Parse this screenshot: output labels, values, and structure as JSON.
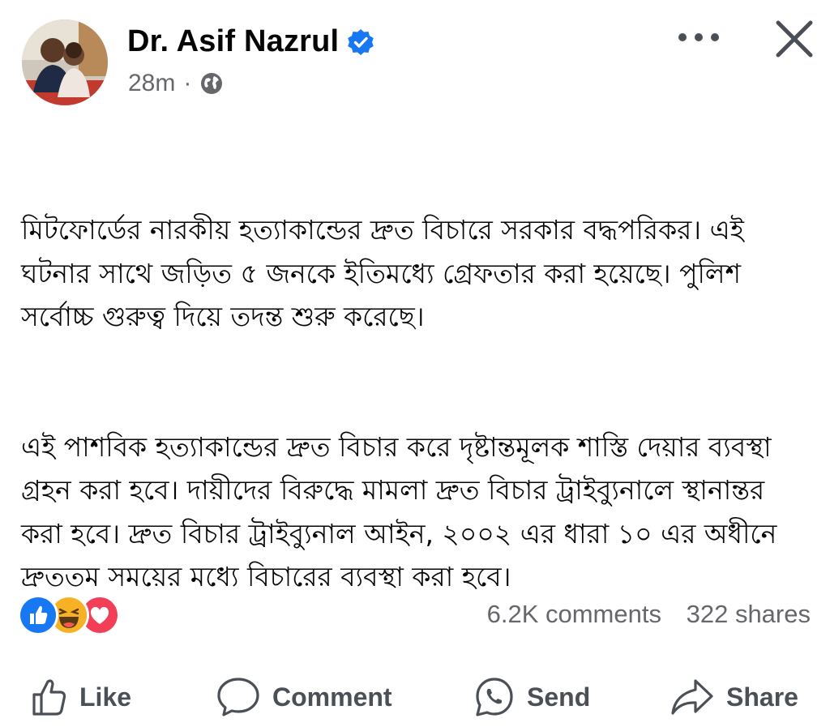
{
  "author": {
    "name": "Dr. Asif Nazrul",
    "verified_icon": "verified-badge-icon",
    "timestamp": "28m",
    "separator": "·",
    "audience_icon": "globe-icon"
  },
  "header_actions": {
    "more_icon": "more-options-icon",
    "close_icon": "close-icon"
  },
  "post": {
    "paragraph_1": "মিটফোর্ডের নারকীয় হত্যাকান্ডের দ্রুত বিচারে সরকার বদ্ধপরিকর। এই ঘটনার সাথে জড়িত ৫ জনকে ইতিমধ্যে গ্রেফতার করা হয়েছে। পুলিশ সর্বোচ্চ গুরুত্ব দিয়ে তদন্ত শুরু করেছে।",
    "paragraph_2": "এই পাশবিক হত্যাকান্ডের দ্রুত বিচার করে দৃষ্টান্তমূলক শাস্তি দেয়ার ব্যবস্থা গ্রহন করা হবে। দায়ীদের বিরুদ্ধে মামলা দ্রুত বিচার ট্রাইব্যুনালে স্থানান্তর করা হবে। দ্রুত বিচার ট্রাইব্যুনাল আইন, ২০০২ এর ধারা ১০ এর অধীনে দ্রুততম সময়ের মধ্যে বিচারের ব্যবস্থা করা হবে।"
  },
  "engagement": {
    "reactions": [
      "like-reaction-icon",
      "haha-reaction-icon",
      "love-reaction-icon"
    ],
    "comments": "6.2K comments",
    "shares": "322 shares"
  },
  "actions": {
    "like": "Like",
    "comment": "Comment",
    "send": "Send",
    "share": "Share"
  },
  "colors": {
    "verified_blue": "#1877f2",
    "secondary_text": "#65676b",
    "love_red": "#f33e58",
    "haha_yellow": "#f7b125"
  }
}
